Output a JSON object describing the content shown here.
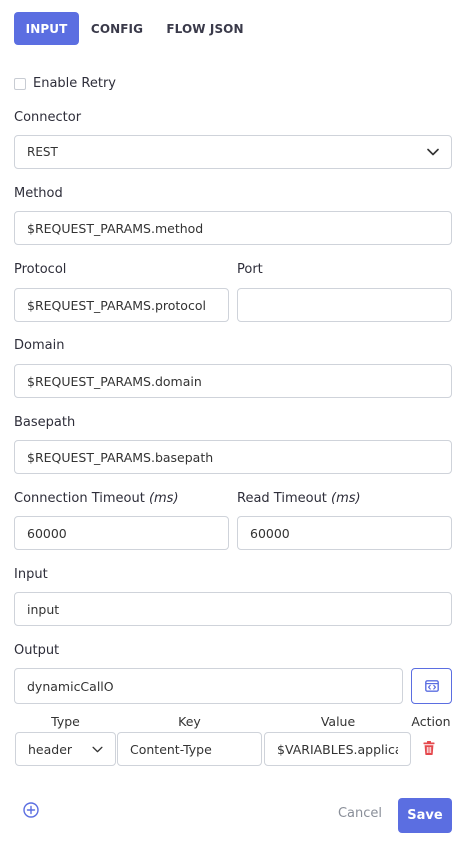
{
  "tabs": [
    {
      "label": "INPUT",
      "active": true
    },
    {
      "label": "CONFIG",
      "active": false
    },
    {
      "label": "FLOW JSON",
      "active": false
    }
  ],
  "enable_retry": {
    "label": "Enable Retry",
    "checked": false
  },
  "connector": {
    "label": "Connector",
    "value": "REST",
    "icon": "chevron-down-icon"
  },
  "method": {
    "label": "Method",
    "value": "$REQUEST_PARAMS.method"
  },
  "protocol": {
    "label": "Protocol",
    "value": "$REQUEST_PARAMS.protocol"
  },
  "port": {
    "label": "Port",
    "value": ""
  },
  "domain": {
    "label": "Domain",
    "value": "$REQUEST_PARAMS.domain"
  },
  "basepath": {
    "label": "Basepath",
    "value": "$REQUEST_PARAMS.basepath"
  },
  "connection_timeout": {
    "label": "Connection Timeout ",
    "unit": "(ms)",
    "value": "60000"
  },
  "read_timeout": {
    "label": "Read Timeout ",
    "unit": "(ms)",
    "value": "60000"
  },
  "input": {
    "label": "Input",
    "value": "input"
  },
  "output": {
    "label": "Output",
    "value": "dynamicCallO",
    "icon": "code-editor-icon"
  },
  "headers_table": {
    "columns": [
      "Type",
      "Key",
      "Value",
      "Action"
    ],
    "rows": [
      {
        "type": "header",
        "key": "Content-Type",
        "value": "$VARIABLES.applicat",
        "action_icon": "trash-icon"
      }
    ]
  },
  "footer": {
    "add_icon": "plus-circle-icon",
    "cancel_label": "Cancel",
    "save_label": "Save"
  },
  "colors": {
    "accent": "#5b6ee1",
    "danger": "#e5484d"
  }
}
